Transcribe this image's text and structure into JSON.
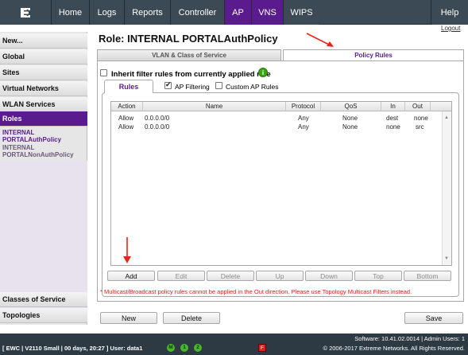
{
  "nav": {
    "tabs": [
      {
        "label": "Home"
      },
      {
        "label": "Logs"
      },
      {
        "label": "Reports"
      },
      {
        "label": "Controller"
      },
      {
        "label": "AP"
      },
      {
        "label": "VNS"
      },
      {
        "label": "WIPS"
      },
      {
        "label": "Help"
      }
    ],
    "logout": "Logout"
  },
  "sidebar": {
    "items": [
      {
        "label": "New..."
      },
      {
        "label": "Global"
      },
      {
        "label": "Sites"
      },
      {
        "label": "Virtual Networks"
      },
      {
        "label": "WLAN Services"
      },
      {
        "label": "Roles"
      }
    ],
    "role_current_line1": "INTERNAL",
    "role_current_line2": "PORTALAuthPolicy",
    "role_other_line1": "INTERNAL",
    "role_other_line2": "PORTALNonAuthPolicy",
    "bottom_items": [
      {
        "label": "Classes of Service"
      },
      {
        "label": "Topologies"
      }
    ]
  },
  "main": {
    "title": "Role: INTERNAL PORTALAuthPolicy",
    "tabs": [
      {
        "label": "VLAN & Class of Service"
      },
      {
        "label": "Policy Rules"
      }
    ],
    "inherit_label": "Inherit filter rules from currently applied role",
    "info_icon": "i",
    "rules_tab": "Rules",
    "ap_filtering": "AP Filtering",
    "custom_ap_rules": "Custom AP Rules",
    "columns": [
      "Action",
      "Name",
      "Protocol",
      "QoS",
      "In",
      "Out"
    ],
    "rows": [
      {
        "action": "Allow",
        "name": "0.0.0.0/0",
        "protocol": "Any",
        "qos": "None",
        "in": "dest",
        "out": "none"
      },
      {
        "action": "Allow",
        "name": "0.0.0.0/0",
        "protocol": "Any",
        "qos": "None",
        "in": "none",
        "out": "src"
      }
    ],
    "actions": {
      "add": "Add",
      "edit": "Edit",
      "delete": "Delete",
      "up": "Up",
      "down": "Down",
      "top": "Top",
      "bottom": "Bottom"
    },
    "note": "* Multicast/Broadcast policy rules cannot be applied in the Out direction. Please use Topology Multicast Filters instead.",
    "buttons": {
      "new": "New",
      "delete": "Delete",
      "save": "Save"
    }
  },
  "footer": {
    "software": "Software: 10.41.02.0014 | Admin Users: 1",
    "copyright": "© 2006-2017  Extreme Networks. All Rights Reserved.",
    "status": "[ EWC | V2110 Small | 00 days, 20:27 ]  User: data1",
    "badges": [
      "M",
      "1",
      "2"
    ],
    "alarm": "F"
  },
  "colors": {
    "brand_purple": "#5a1b8f",
    "nav_dark": "#3b4a55",
    "note_red": "#d9201c",
    "arrow_red": "#e8231c",
    "status_green": "#48b72b"
  }
}
